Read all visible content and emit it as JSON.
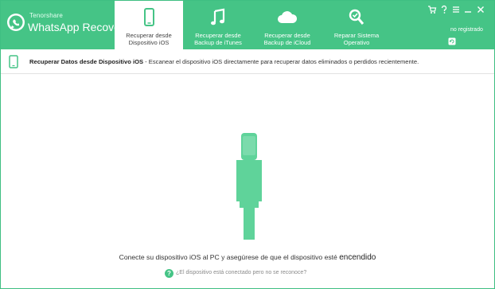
{
  "app": {
    "brand": "Tenorshare",
    "product": "WhatsApp Recovery"
  },
  "tabs": [
    {
      "label_line1": "Recuperar desde",
      "label_line2": "Dispositivo iOS",
      "icon": "phone-icon",
      "active": true
    },
    {
      "label_line1": "Recuperar desde",
      "label_line2": "Backup de iTunes",
      "icon": "music-note-icon",
      "active": false
    },
    {
      "label_line1": "Recuperar desde",
      "label_line2": "Backup de iCloud",
      "icon": "cloud-icon",
      "active": false
    },
    {
      "label_line1": "Reparar Sistema",
      "label_line2": "Operativo",
      "icon": "wrench-search-icon",
      "active": false
    }
  ],
  "window_controls": [
    "cart-icon",
    "help-icon",
    "menu-icon",
    "minimize-icon",
    "close-icon"
  ],
  "registration": {
    "status": "no registrado"
  },
  "infobar": {
    "title": "Recuperar Datos desde Dispositivo iOS",
    "description": " - Escanear el dispositivo iOS directamente para recuperar datos eliminados o perdidos recientemente."
  },
  "main": {
    "prompt_text": "Conecte su dispositivo iOS al PC y asegúrese de que el dispositivo esté ",
    "prompt_emphasis": "encendido",
    "help_link": "¿El dispositivo está conectado pero no se reconoce?"
  },
  "colors": {
    "accent": "#45c486",
    "cable": "#5fd39a",
    "border": "#3fbf82"
  }
}
